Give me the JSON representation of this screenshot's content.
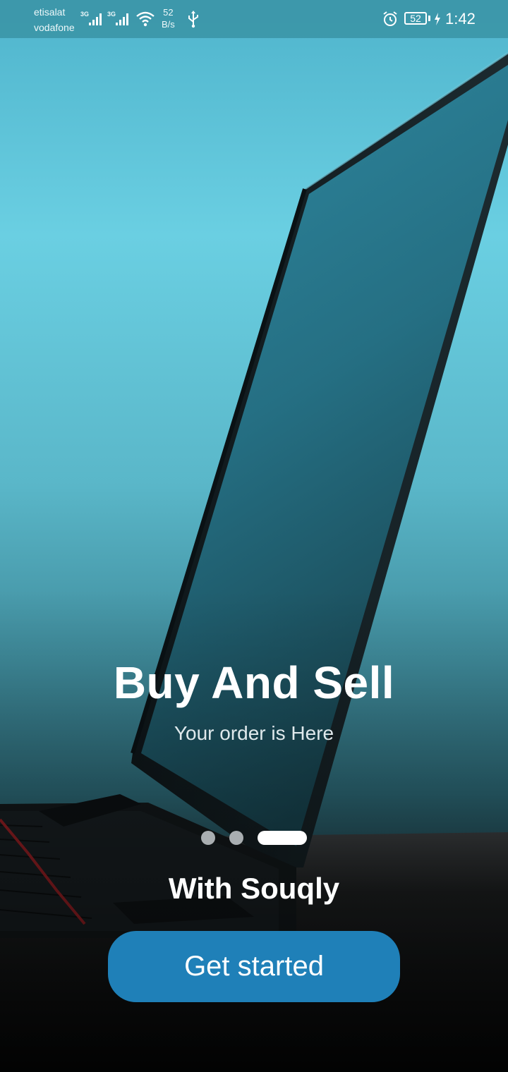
{
  "status_bar": {
    "carrier_1": "etisalat",
    "carrier_2": "vodafone",
    "network_1": "3G",
    "network_2": "3G",
    "net_speed_value": "52",
    "net_speed_unit": "B/s",
    "battery_level": "52",
    "time": "1:42",
    "icons": [
      "signal-icon",
      "signal-icon",
      "wifi-icon",
      "usb-icon",
      "alarm-icon",
      "battery-icon",
      "charging-icon"
    ]
  },
  "onboarding": {
    "title": "Buy And Sell",
    "subtitle": "Your order is Here",
    "tagline": "With Souqly",
    "page_indicator": {
      "total": 3,
      "active_index": 2
    },
    "cta_label": "Get started"
  },
  "colors": {
    "cta_background": "#1f80b8",
    "status_bar": "#3c96a8",
    "sky_top": "#4fb4cc",
    "sky_mid": "#6acfe2",
    "floor": "#0b0d0e"
  }
}
